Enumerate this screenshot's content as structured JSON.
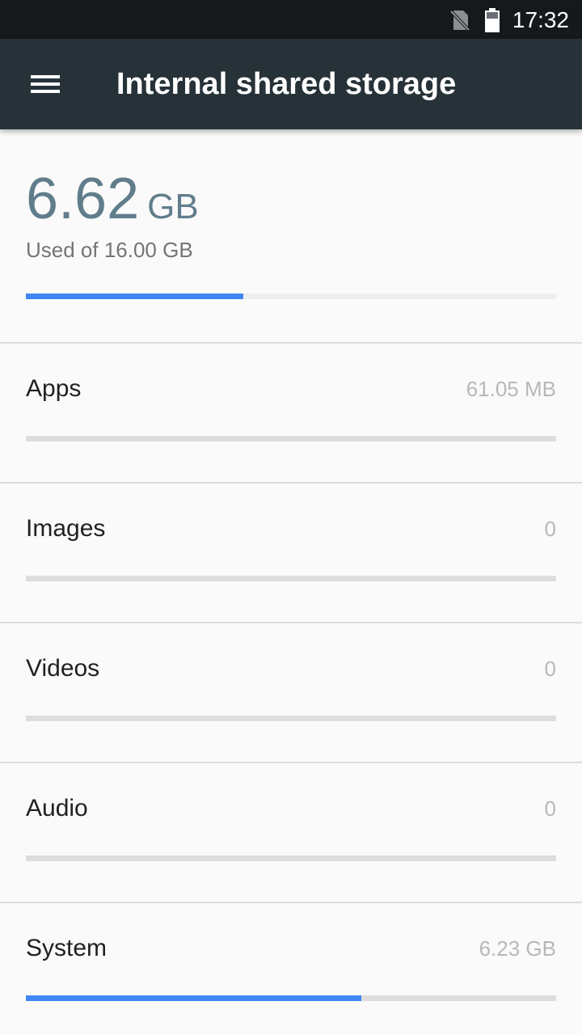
{
  "status_bar": {
    "time": "17:32",
    "icons": [
      "no-sim-icon",
      "battery-icon"
    ]
  },
  "app_bar": {
    "title": "Internal shared storage",
    "menu_icon": "menu-icon"
  },
  "summary": {
    "used_value": "6.62",
    "used_unit": "GB",
    "caption": "Used of 16.00 GB",
    "used_fraction": 0.41
  },
  "categories": [
    {
      "label": "Apps",
      "size": "61.05 MB",
      "fraction": 0.0
    },
    {
      "label": "Images",
      "size": "0",
      "fraction": 0.0
    },
    {
      "label": "Videos",
      "size": "0",
      "fraction": 0.0
    },
    {
      "label": "Audio",
      "size": "0",
      "fraction": 0.0
    },
    {
      "label": "System",
      "size": "6.23 GB",
      "fraction": 0.632
    }
  ],
  "colors": {
    "accent": "#4285f4",
    "app_bar": "#263238",
    "status_bar": "#16191c",
    "used_amount": "#607d8b"
  }
}
